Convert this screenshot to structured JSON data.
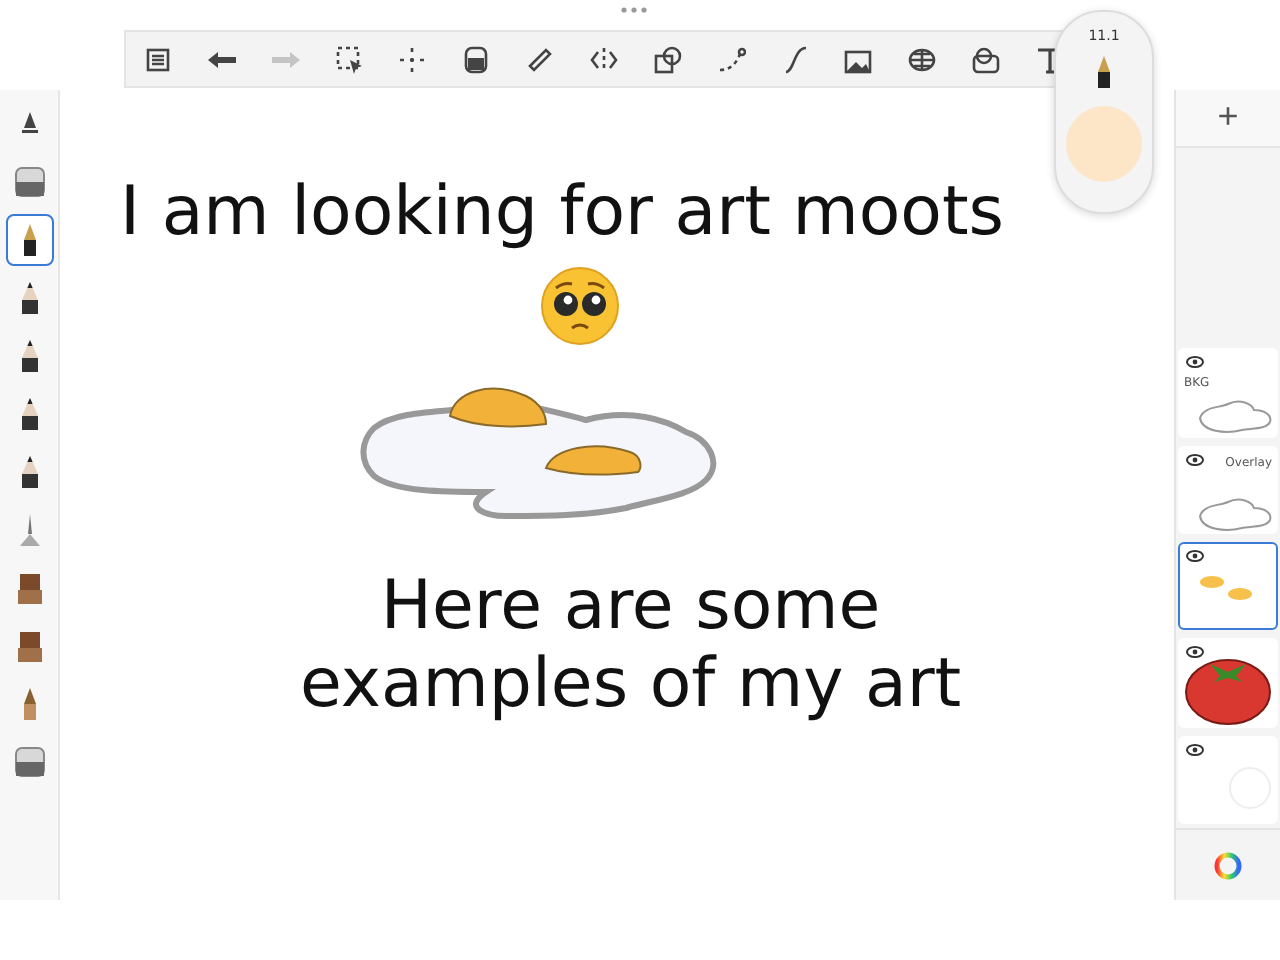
{
  "toolbar": {
    "tools": [
      {
        "kind": "list",
        "disabled": false
      },
      {
        "kind": "undo",
        "disabled": false
      },
      {
        "kind": "redo",
        "disabled": true
      },
      {
        "kind": "select",
        "disabled": false
      },
      {
        "kind": "transform",
        "disabled": false
      },
      {
        "kind": "fill",
        "disabled": false
      },
      {
        "kind": "ruler",
        "disabled": false
      },
      {
        "kind": "symmetry",
        "disabled": false
      },
      {
        "kind": "shapes",
        "disabled": false
      },
      {
        "kind": "stroke",
        "disabled": false
      },
      {
        "kind": "curve",
        "disabled": false
      },
      {
        "kind": "image",
        "disabled": false
      },
      {
        "kind": "perspective",
        "disabled": false
      },
      {
        "kind": "timelapse",
        "disabled": false
      },
      {
        "kind": "text",
        "disabled": false
      }
    ]
  },
  "brush_popover": {
    "size": "11.1",
    "color": "#fde6c8"
  },
  "brushes": [
    {
      "kind": "pen",
      "selected": false
    },
    {
      "kind": "eraser",
      "selected": false
    },
    {
      "kind": "nib",
      "selected": true
    },
    {
      "kind": "pencil",
      "selected": false
    },
    {
      "kind": "pencil",
      "selected": false
    },
    {
      "kind": "pencil",
      "selected": false
    },
    {
      "kind": "pencil",
      "selected": false
    },
    {
      "kind": "airbrush",
      "selected": false
    },
    {
      "kind": "block",
      "selected": false
    },
    {
      "kind": "block",
      "selected": false
    },
    {
      "kind": "marker",
      "selected": false
    },
    {
      "kind": "eraser",
      "selected": false
    }
  ],
  "canvas": {
    "heading": "I am looking for art moots",
    "caption": "Here are some\nexamples of my art"
  },
  "layers": {
    "add_label": "+",
    "items": [
      {
        "kind": "sketch",
        "name": "BKG",
        "selected": false
      },
      {
        "kind": "sketch",
        "name": "Overlay",
        "selected": false
      },
      {
        "kind": "yolks",
        "selected": true
      },
      {
        "kind": "tomato",
        "selected": false
      },
      {
        "kind": "blank",
        "selected": false
      }
    ]
  }
}
